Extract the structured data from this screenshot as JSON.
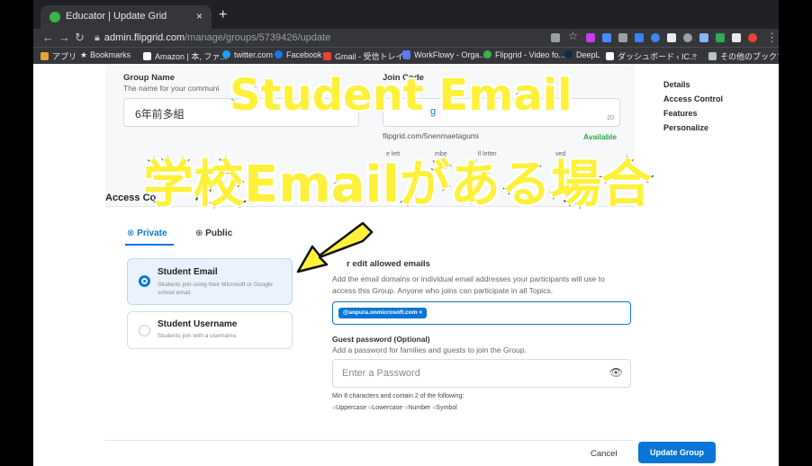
{
  "browser": {
    "tab_title": "Educator | Update Grid",
    "tab_close": "×",
    "new_tab": "+",
    "url_domain": "admin.flipgrid.com",
    "url_path": "/manage/groups/5739426/update",
    "bookmarks": [
      {
        "label": "アプリ",
        "color": "#e8a33a"
      },
      {
        "label": "Bookmarks",
        "color": "#e8eaed"
      },
      {
        "label": "Amazon | 本, ファ...",
        "color": "#ffffff"
      },
      {
        "label": "twitter.com",
        "color": "#1da1f2"
      },
      {
        "label": "Facebook",
        "color": "#1877f2"
      },
      {
        "label": "Gmail - 受信トレイ...",
        "color": "#ea4335"
      },
      {
        "label": "WorkFlowy - Orga...",
        "color": "#5b7cfa"
      },
      {
        "label": "Flipgrid - Video fo...",
        "color": "#39b54a"
      },
      {
        "label": "DeepL",
        "color": "#0f2b46"
      },
      {
        "label": "ダッシュボード ‹ IC...",
        "color": "#ffffff"
      },
      {
        "label": "»",
        "color": ""
      },
      {
        "label": "その他のブックマーク",
        "color": "#bdc1c6"
      }
    ]
  },
  "form": {
    "group_name_label": "Group Name",
    "group_name_hint": "The name for your communi",
    "group_name_value": "6年前多組",
    "join_code_label": "Join Code",
    "join_code_hint": "c",
    "join_code_partial": "g",
    "join_code_count": "20",
    "join_url": "flipgrid.com/5nenmaetagumi",
    "availability": "Available",
    "join_note_1": "e lett",
    "join_note_2": "mbe",
    "join_note_3": "ll letter",
    "join_note_4": "ved",
    "access_heading": "Access Co",
    "tabs": {
      "private": "Private",
      "public": "Public"
    },
    "options": [
      {
        "title": "Student Email",
        "desc": "Students join using their Microsoft or Google school email."
      },
      {
        "title": "Student Username",
        "desc": "Students join with a username."
      }
    ],
    "allowed_heading_visible": "r edit allowed emails",
    "allowed_desc": "Add the email domains or individual email addresses your participants will use to access this Group. Anyone who joins can participate in all Topics.",
    "allowed_chip": "@aopura.onmicrosoft.com ×",
    "guest_label": "Guest password (Optional)",
    "guest_desc": "Add a password for families and guests to join the Group.",
    "password_placeholder": "Enter a Password",
    "pw_rules": "Min 8 characters and contain 2 of the following:",
    "pw_checks": [
      "Uppercase",
      "Lowercase",
      "Number",
      "Symbol"
    ],
    "cancel": "Cancel",
    "update": "Update Group"
  },
  "right_nav": [
    "Details",
    "Access Control",
    "Features",
    "Personalize"
  ],
  "overlay": {
    "caption_top": "Student Email",
    "caption_mid": "学校Emailがある場合"
  },
  "colors": {
    "accent": "#0a76d8",
    "available": "#2aa84a",
    "caption": "#fff13a"
  }
}
